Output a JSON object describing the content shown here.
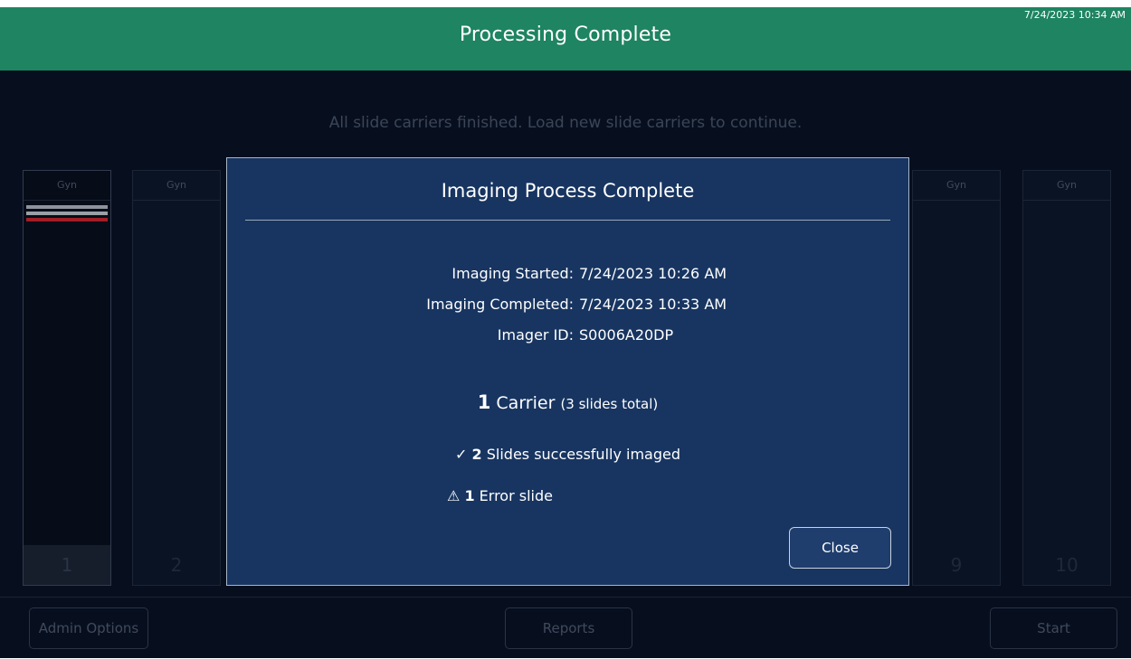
{
  "header": {
    "title": "Processing Complete",
    "clock": "7/24/2023 10:34 AM"
  },
  "instruction": "All slide carriers finished. Load new slide carriers to continue.",
  "carriers": [
    {
      "tag": "Gyn",
      "number": "1"
    },
    {
      "tag": "Gyn",
      "number": "2"
    },
    {
      "tag": "Gyn",
      "number": "9"
    },
    {
      "tag": "Gyn",
      "number": "10"
    }
  ],
  "carrier1_slots": [
    "#8d939c",
    "#9b9fa6",
    "#a21e26"
  ],
  "bottom": {
    "admin": "Admin Options",
    "reports": "Reports",
    "start": "Start"
  },
  "modal": {
    "title": "Imaging Process Complete",
    "started_label": "Imaging Started:",
    "started_value": "7/24/2023 10:26 AM",
    "completed_label": "Imaging Completed:",
    "completed_value": "7/24/2023 10:33 AM",
    "imager_label": "Imager ID:",
    "imager_value": "S0006A20DP",
    "carrier_count": "1",
    "carrier_word": "Carrier",
    "carrier_detail": "(3 slides total)",
    "success_icon": "✓",
    "success_count": "2",
    "success_text": "Slides successfully imaged",
    "error_icon": "⚠",
    "error_count": "1",
    "error_text": "Error slide",
    "close_label": "Close"
  },
  "colors": {
    "header": "#1e8461",
    "modal": "#183561",
    "background": "#070f1f",
    "error_slot": "#a21e26"
  }
}
